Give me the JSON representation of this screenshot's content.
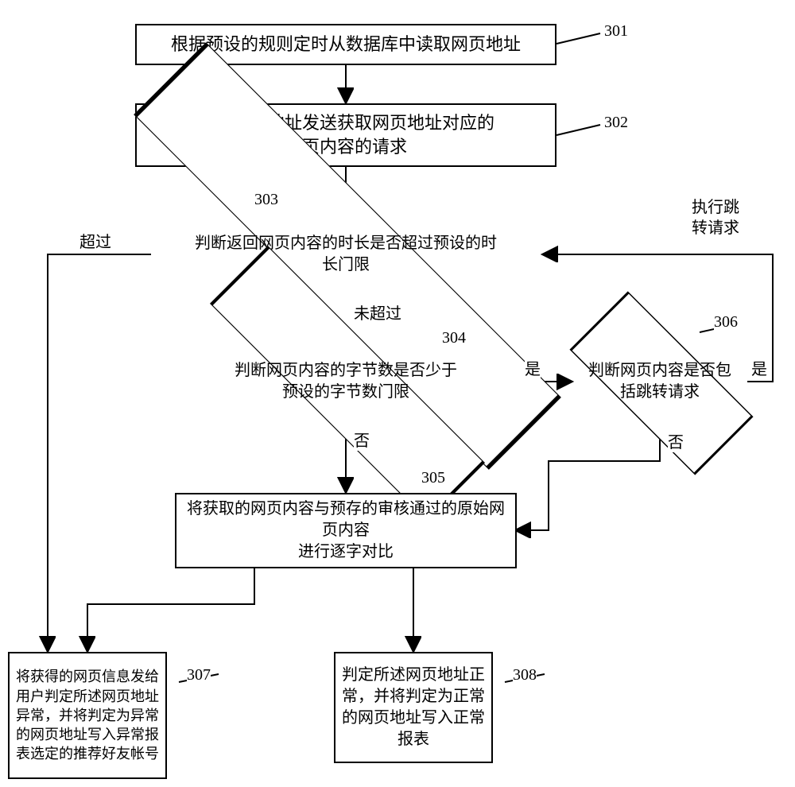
{
  "chart_data": {
    "type": "flowchart",
    "nodes": [
      {
        "id": "301",
        "type": "process",
        "text": "根据预设的规则定时从数据库中读取网页地址"
      },
      {
        "id": "302",
        "type": "process",
        "text": "根据网页地址发送获取网页地址对应的\n网页内容的请求"
      },
      {
        "id": "303",
        "type": "decision",
        "text": "判断返回网页内容的时长是否超过预设的时\n长门限"
      },
      {
        "id": "304",
        "type": "decision",
        "text": "判断网页内容的字节数是否少于\n预设的字节数门限"
      },
      {
        "id": "305",
        "type": "process",
        "text": "将获取的网页内容与预存的审核通过的原始网页内容\n进行逐字对比"
      },
      {
        "id": "306",
        "type": "decision",
        "text": "判断网页内容是否包\n括跳转请求"
      },
      {
        "id": "307",
        "type": "process",
        "text": "将获得的网页信息发给用户判定所述网页地址异常，并将判定为异常的网页地址写入异常报表选定的推荐好友帐号"
      },
      {
        "id": "308",
        "type": "process",
        "text": "判定所述网页地址正\n常，并将判定为正常\n的网页地址写入正常\n报表"
      }
    ],
    "edges": [
      {
        "from": "301",
        "to": "302"
      },
      {
        "from": "302",
        "to": "303"
      },
      {
        "from": "303",
        "to": "304",
        "label": "未超过"
      },
      {
        "from": "303",
        "to": "307",
        "label": "超过"
      },
      {
        "from": "304",
        "to": "306",
        "label": "是"
      },
      {
        "from": "304",
        "to": "305",
        "label": "否"
      },
      {
        "from": "305",
        "to": "307"
      },
      {
        "from": "305",
        "to": "308"
      },
      {
        "from": "306",
        "to": "303",
        "label": "是",
        "note": "执行跳转请求"
      },
      {
        "from": "306",
        "to": "305",
        "label": "否"
      }
    ]
  },
  "nodes": {
    "n301": "根据预设的规则定时从数据库中读取网页地址",
    "n302_l1": "根据网页地址发送获取网页地址对应的",
    "n302_l2": "网页内容的请求",
    "n303_l1": "判断返回网页内容的时长是否超过预设的时",
    "n303_l2": "长门限",
    "n304_l1": "判断网页内容的字节数是否少于",
    "n304_l2": "预设的字节数门限",
    "n305_l1": "将获取的网页内容与预存的审核通过的原始网页内容",
    "n305_l2": "进行逐字对比",
    "n306_l1": "判断网页内容是否包",
    "n306_l2": "括跳转请求",
    "n307": "将获得的网页信息发给用户判定所述网页地址异常，并将判定为异常的网页地址写入异常报表选定的推荐好友帐号",
    "n308_l1": "判定所述网页地址正",
    "n308_l2": "常，并将判定为正常",
    "n308_l3": "的网页地址写入正常",
    "n308_l4": "报表"
  },
  "labels": {
    "L301": "301",
    "L302": "302",
    "L303": "303",
    "L304": "304",
    "L305": "305",
    "L306": "306",
    "L307": "307",
    "L308": "308",
    "exceed": "超过",
    "not_exceed": "未超过",
    "yes_304": "是",
    "no_304": "否",
    "yes_306": "是",
    "no_306": "否",
    "jump_l1": "执行跳",
    "jump_l2": "转请求"
  }
}
